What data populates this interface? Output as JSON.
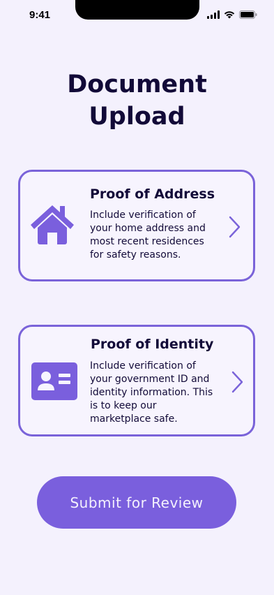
{
  "status_bar": {
    "time": "9:41"
  },
  "page": {
    "title_line1": "Document",
    "title_line2": "Upload"
  },
  "cards": [
    {
      "title": "Proof of Address",
      "description": "Include verification of your home address and most recent residences for safety reasons.",
      "icon": "house-icon"
    },
    {
      "title": "Proof of Identity",
      "description": "Include verification of your government ID and identity information. This is to keep our marketplace safe.",
      "icon": "id-card-icon"
    }
  ],
  "submit": {
    "label": "Submit for Review"
  },
  "colors": {
    "background": "#F4F1FD",
    "accent": "#7A5FDD",
    "text": "#120A38"
  }
}
